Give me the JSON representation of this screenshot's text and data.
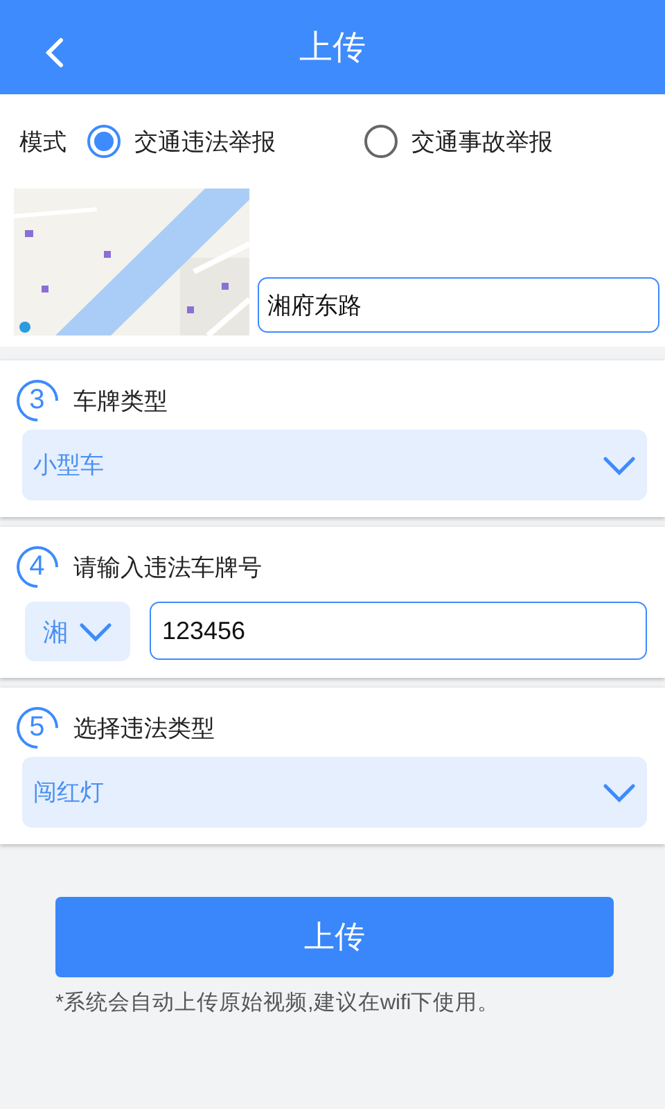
{
  "header": {
    "title": "上传"
  },
  "mode": {
    "label": "模式",
    "options": [
      {
        "label": "交通违法举报",
        "selected": true
      },
      {
        "label": "交通事故举报",
        "selected": false
      }
    ]
  },
  "location": {
    "address": "湘府东路"
  },
  "sections": [
    {
      "number": "3",
      "title": "车牌类型",
      "kind": "select",
      "value": "小型车"
    },
    {
      "number": "4",
      "title": "请输入违法车牌号",
      "kind": "plate",
      "province": "湘",
      "plate_number": "123456"
    },
    {
      "number": "5",
      "title": "选择违法类型",
      "kind": "select",
      "value": "闯红灯"
    }
  ],
  "upload_button": "上传",
  "note": "*系统会自动上传原始视频,建议在wifi下使用。"
}
